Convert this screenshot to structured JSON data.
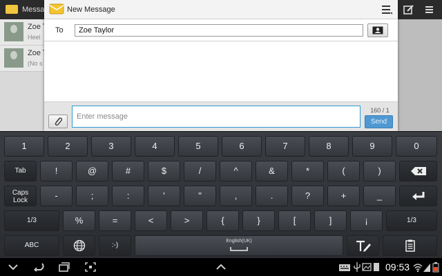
{
  "background": {
    "app_title": "Messag",
    "rows": [
      {
        "name": "Zoe T",
        "sub": "Heel"
      },
      {
        "name": "Zoe T",
        "sub": "(No s"
      }
    ]
  },
  "dialog": {
    "title": "New Message",
    "to_label": "To",
    "recipient": "Zoe Taylor",
    "message_placeholder": "Enter message",
    "counter": "160 / 1",
    "send_label": "Send"
  },
  "keyboard": {
    "row1": [
      "1",
      "2",
      "3",
      "4",
      "5",
      "6",
      "7",
      "8",
      "9",
      "0"
    ],
    "row2": {
      "tab": "Tab",
      "keys": [
        "!",
        "@",
        "#",
        "$",
        "/",
        "^",
        "&",
        "*",
        "(",
        ")"
      ]
    },
    "row3": {
      "caps": "Caps\nLock",
      "keys": [
        "-",
        ";",
        ":",
        "'",
        "\"",
        ",",
        ".",
        "?",
        "+",
        "_"
      ]
    },
    "row4": {
      "page_left": "1/3",
      "keys": [
        "%",
        "=",
        "<",
        ">",
        "{",
        "}",
        "[",
        "]",
        "¡"
      ],
      "page_right": "1/3"
    },
    "row5": {
      "abc": "ABC",
      "smiley": ":-)",
      "space_label": "English(UK)"
    }
  },
  "statusbar": {
    "time": "09:53"
  },
  "colors": {
    "accent": "#4f98d2",
    "keyboard_bg": "#2f3236",
    "input_border": "#2f9ad6"
  }
}
